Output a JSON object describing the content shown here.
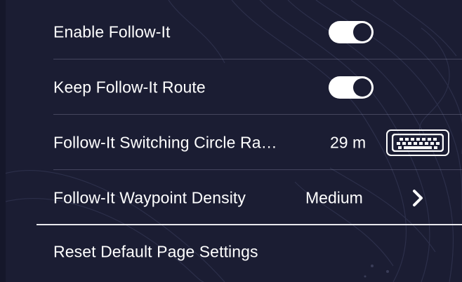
{
  "settings": {
    "enable_follow_it": {
      "label": "Enable Follow-It",
      "on": true
    },
    "keep_route": {
      "label": "Keep Follow-It Route",
      "on": true
    },
    "switching_radius": {
      "label": "Follow-It Switching Circle Ra…",
      "value": "29 m",
      "icon": "keyboard-icon"
    },
    "waypoint_density": {
      "label": "Follow-It Waypoint Density",
      "value": "Medium",
      "icon": "chevron-right-icon"
    },
    "reset": {
      "label": "Reset Default Page Settings"
    }
  },
  "colors": {
    "background": "#1b1d33",
    "text": "#ffffff",
    "divider": "#5a5c75"
  }
}
